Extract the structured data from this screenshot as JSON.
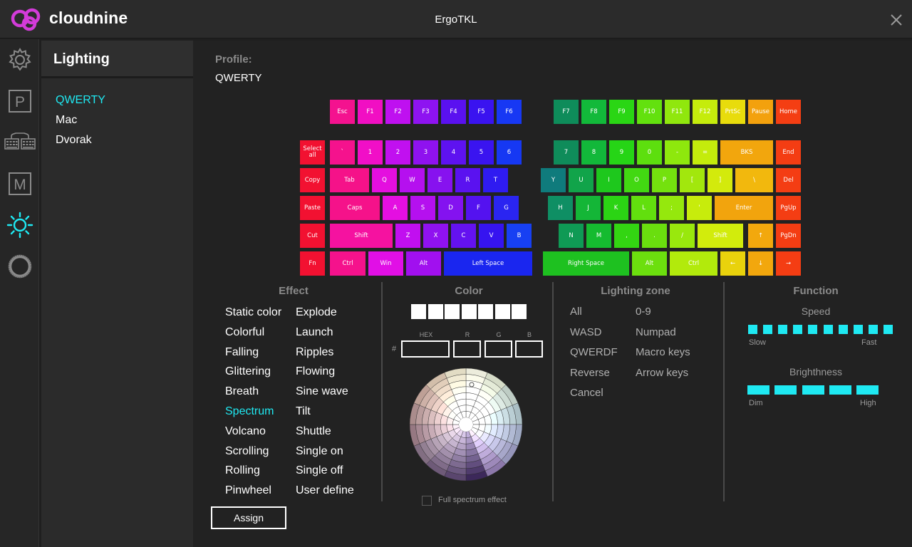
{
  "app": {
    "brand": "cloudnine",
    "title": "ErgoTKL",
    "accent": "#1fe9f2",
    "logo_color": "#d33bd9"
  },
  "rail": {
    "icons": [
      "gear-icon",
      "p-icon",
      "keyboard-icon",
      "m-icon",
      "sun-icon",
      "ring-icon"
    ],
    "active": "sun-icon"
  },
  "sidebar": {
    "title": "Lighting",
    "profiles": [
      {
        "label": "QWERTY",
        "active": true
      },
      {
        "label": "Mac",
        "active": false
      },
      {
        "label": "Dvorak",
        "active": false
      }
    ]
  },
  "profile": {
    "label": "Profile:",
    "value": "QWERTY"
  },
  "keyboard": {
    "function_row": [
      {
        "label": "Esc",
        "color": "#f4128f"
      },
      {
        "label": "F1",
        "color": "#f10fc3"
      },
      {
        "label": "F2",
        "color": "#bf10f0"
      },
      {
        "label": "F3",
        "color": "#8e13f1"
      },
      {
        "label": "F4",
        "color": "#5a11f0"
      },
      {
        "label": "F5",
        "color": "#3a13f0"
      },
      {
        "label": "F6",
        "color": "#1738f4"
      },
      {
        "label": "F7",
        "color": "#0e8c5a"
      },
      {
        "label": "F8",
        "color": "#12b93a"
      },
      {
        "label": "F9",
        "color": "#2ad614"
      },
      {
        "label": "F10",
        "color": "#63e10e"
      },
      {
        "label": "F11",
        "color": "#90e70d"
      },
      {
        "label": "F12",
        "color": "#c5ec0c"
      },
      {
        "label": "PrtSc",
        "color": "#e8dc0c"
      },
      {
        "label": "Pause",
        "color": "#f3a10d"
      },
      {
        "label": "Home",
        "color": "#f43e13"
      }
    ],
    "macro_keys": [
      {
        "label": "Select all",
        "color": "#f21131"
      },
      {
        "label": "Copy",
        "color": "#f21131"
      },
      {
        "label": "Paste",
        "color": "#f21131"
      },
      {
        "label": "Cut",
        "color": "#f21131"
      },
      {
        "label": "Fn",
        "color": "#f21131"
      }
    ],
    "left": [
      {
        "label": "`",
        "color": "#f5128d"
      },
      {
        "label": "1",
        "color": "#f10fc7"
      },
      {
        "label": "2",
        "color": "#c110f0"
      },
      {
        "label": "3",
        "color": "#8f12ef"
      },
      {
        "label": "4",
        "color": "#5e12f0"
      },
      {
        "label": "5",
        "color": "#3a14f0"
      },
      {
        "label": "6",
        "color": "#1638f3"
      },
      {
        "label": "Tab",
        "color": "#f51289"
      },
      {
        "label": "Q",
        "color": "#e40fdf"
      },
      {
        "label": "W",
        "color": "#b510ef"
      },
      {
        "label": "E",
        "color": "#8712ef"
      },
      {
        "label": "R",
        "color": "#5a12f0"
      },
      {
        "label": "T",
        "color": "#2f1bf1"
      },
      {
        "label": "Caps",
        "color": "#f5128a"
      },
      {
        "label": "A",
        "color": "#e40fe1"
      },
      {
        "label": "S",
        "color": "#b510ef"
      },
      {
        "label": "D",
        "color": "#8412f0"
      },
      {
        "label": "F",
        "color": "#5412f0"
      },
      {
        "label": "G",
        "color": "#2a25f1"
      },
      {
        "label": "Shift",
        "color": "#f512a0"
      },
      {
        "label": "Z",
        "color": "#c10ff0"
      },
      {
        "label": "X",
        "color": "#9012f0"
      },
      {
        "label": "C",
        "color": "#6412f0"
      },
      {
        "label": "V",
        "color": "#3614f0"
      },
      {
        "label": "B",
        "color": "#1740f3"
      },
      {
        "label": "Ctrl",
        "color": "#f5128c"
      },
      {
        "label": "Win",
        "color": "#e10fe6"
      },
      {
        "label": "Alt",
        "color": "#a110ef"
      },
      {
        "label": "Left Space",
        "color": "#1a26ef"
      }
    ],
    "right": [
      {
        "label": "7",
        "color": "#0f8c5a"
      },
      {
        "label": "8",
        "color": "#12b83a"
      },
      {
        "label": "9",
        "color": "#26d516"
      },
      {
        "label": "0",
        "color": "#5ddf0e"
      },
      {
        "label": "-",
        "color": "#8ee80d"
      },
      {
        "label": "=",
        "color": "#c4ec0c"
      },
      {
        "label": "BKS",
        "color": "#f2a60d"
      },
      {
        "label": "End",
        "color": "#f43d13"
      },
      {
        "label": "Y",
        "color": "#0f7b7c"
      },
      {
        "label": "U",
        "color": "#11a44a"
      },
      {
        "label": "I",
        "color": "#1ec81d"
      },
      {
        "label": "O",
        "color": "#42d812"
      },
      {
        "label": "P",
        "color": "#74e10e"
      },
      {
        "label": "[",
        "color": "#a2e70d"
      },
      {
        "label": "]",
        "color": "#d3ea0c"
      },
      {
        "label": "\\",
        "color": "#f2b80d"
      },
      {
        "label": "Del",
        "color": "#f43d13"
      },
      {
        "label": "H",
        "color": "#0f8f64"
      },
      {
        "label": "J",
        "color": "#14b637"
      },
      {
        "label": "K",
        "color": "#2bd414"
      },
      {
        "label": "L",
        "color": "#62df0e"
      },
      {
        "label": ";",
        "color": "#95e80d"
      },
      {
        "label": "'",
        "color": "#c7ec0c"
      },
      {
        "label": "Enter",
        "color": "#f2a40d"
      },
      {
        "label": "PgUp",
        "color": "#f43d13"
      },
      {
        "label": "N",
        "color": "#0f9a55"
      },
      {
        "label": "M",
        "color": "#15bb30"
      },
      {
        "label": ",",
        "color": "#33d512"
      },
      {
        "label": ".",
        "color": "#6ade0e"
      },
      {
        "label": "/",
        "color": "#99e80d"
      },
      {
        "label": "Shift",
        "color": "#d2ec0c"
      },
      {
        "label": "↑",
        "color": "#f2a80d"
      },
      {
        "label": "PgDn",
        "color": "#f43d13"
      },
      {
        "label": "Right Space",
        "color": "#1ec120"
      },
      {
        "label": "Alt",
        "color": "#6cdf0e"
      },
      {
        "label": "Ctrl",
        "color": "#b2ea0c"
      },
      {
        "label": "←",
        "color": "#e9d20c"
      },
      {
        "label": "↓",
        "color": "#f2a70d"
      },
      {
        "label": "→",
        "color": "#f43d13"
      }
    ]
  },
  "effect": {
    "header": "Effect",
    "items": [
      "Static color",
      "Explode",
      "Colorful",
      "Launch",
      "Falling",
      "Ripples",
      "Glittering",
      "Flowing",
      "Breath",
      "Sine wave",
      "Spectrum",
      "Tilt",
      "Volcano",
      "Shuttle",
      "Scrolling",
      "Single on",
      "Rolling",
      "Single off",
      "Pinwheel",
      "User define"
    ],
    "selected": "Spectrum",
    "assign_label": "Assign"
  },
  "color": {
    "header": "Color",
    "swatches": [
      "#ffffff",
      "#ffffff",
      "#ffffff",
      "#ffffff",
      "#ffffff",
      "#ffffff",
      "#ffffff"
    ],
    "hash": "#",
    "hex_label": "HEX",
    "r_label": "R",
    "g_label": "G",
    "b_label": "B",
    "hex_value": "",
    "r_value": "",
    "g_value": "",
    "b_value": "",
    "full_spectrum_label": "Full spectrum effect",
    "full_spectrum_checked": false
  },
  "zone": {
    "header": "Lighting zone",
    "items": [
      "All",
      "0-9",
      "WASD",
      "Numpad",
      "QWERDF",
      "Macro keys",
      "Reverse",
      "Arrow keys",
      "Cancel"
    ]
  },
  "function": {
    "header": "Function",
    "speed_label": "Speed",
    "speed_min": "Slow",
    "speed_max": "Fast",
    "speed_level": 10,
    "speed_steps": 10,
    "brightness_label": "Brighthness",
    "brightness_min": "Dim",
    "brightness_max": "High",
    "brightness_level": 5,
    "brightness_steps": 5
  }
}
